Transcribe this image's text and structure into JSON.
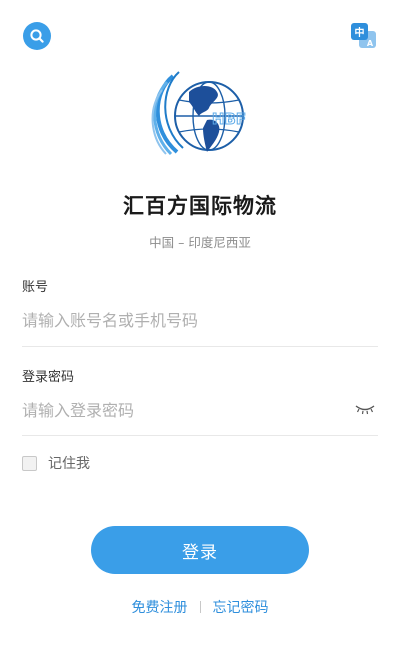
{
  "header": {
    "search_icon": "search-icon",
    "language_icon": "language-translate-icon",
    "language_glyph": "中",
    "language_glyph_en": "A"
  },
  "brand": {
    "logo_text": "HBF",
    "name": "汇百方国际物流",
    "route": "中国 – 印度尼西亚"
  },
  "form": {
    "account_label": "账号",
    "account_placeholder": "请输入账号名或手机号码",
    "password_label": "登录密码",
    "password_placeholder": "请输入登录密码",
    "remember_label": "记住我",
    "login_label": "登录"
  },
  "links": {
    "register": "免费注册",
    "forgot": "忘记密码"
  },
  "colors": {
    "accent": "#3a9ee8",
    "link": "#2f8fdc"
  }
}
